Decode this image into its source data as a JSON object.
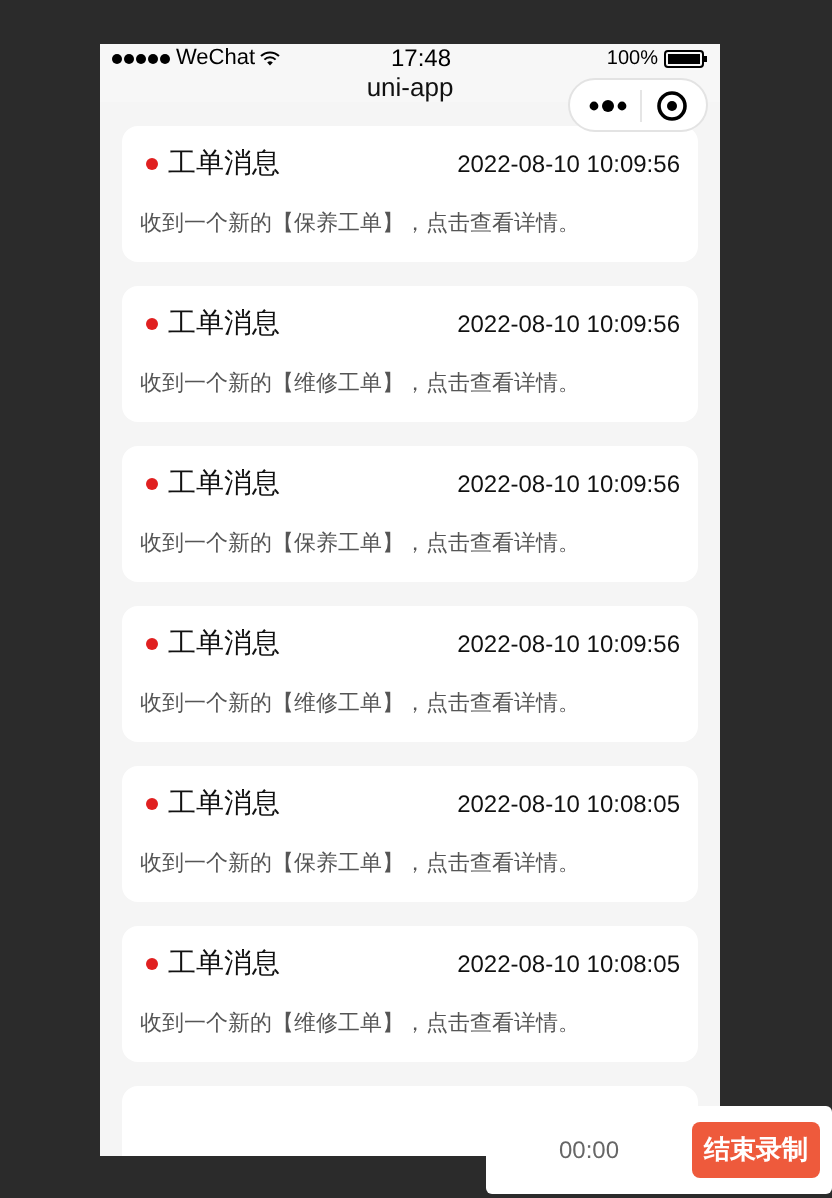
{
  "status_bar": {
    "carrier": "WeChat",
    "time": "17:48",
    "battery": "100%"
  },
  "nav_bar": {
    "title": "uni-app"
  },
  "messages": [
    {
      "title": "工单消息",
      "time": "2022-08-10 10:09:56",
      "text": "收到一个新的【保养工单】，点击查看详情。",
      "unread": true
    },
    {
      "title": "工单消息",
      "time": "2022-08-10 10:09:56",
      "text": "收到一个新的【维修工单】，点击查看详情。",
      "unread": true
    },
    {
      "title": "工单消息",
      "time": "2022-08-10 10:09:56",
      "text": "收到一个新的【保养工单】，点击查看详情。",
      "unread": true
    },
    {
      "title": "工单消息",
      "time": "2022-08-10 10:09:56",
      "text": "收到一个新的【维修工单】，点击查看详情。",
      "unread": true
    },
    {
      "title": "工单消息",
      "time": "2022-08-10 10:08:05",
      "text": "收到一个新的【保养工单】，点击查看详情。",
      "unread": true
    },
    {
      "title": "工单消息",
      "time": "2022-08-10 10:08:05",
      "text": "收到一个新的【维修工单】，点击查看详情。",
      "unread": true
    }
  ],
  "recorder": {
    "elapsed": "00:00",
    "stop_button": "结束录制"
  }
}
